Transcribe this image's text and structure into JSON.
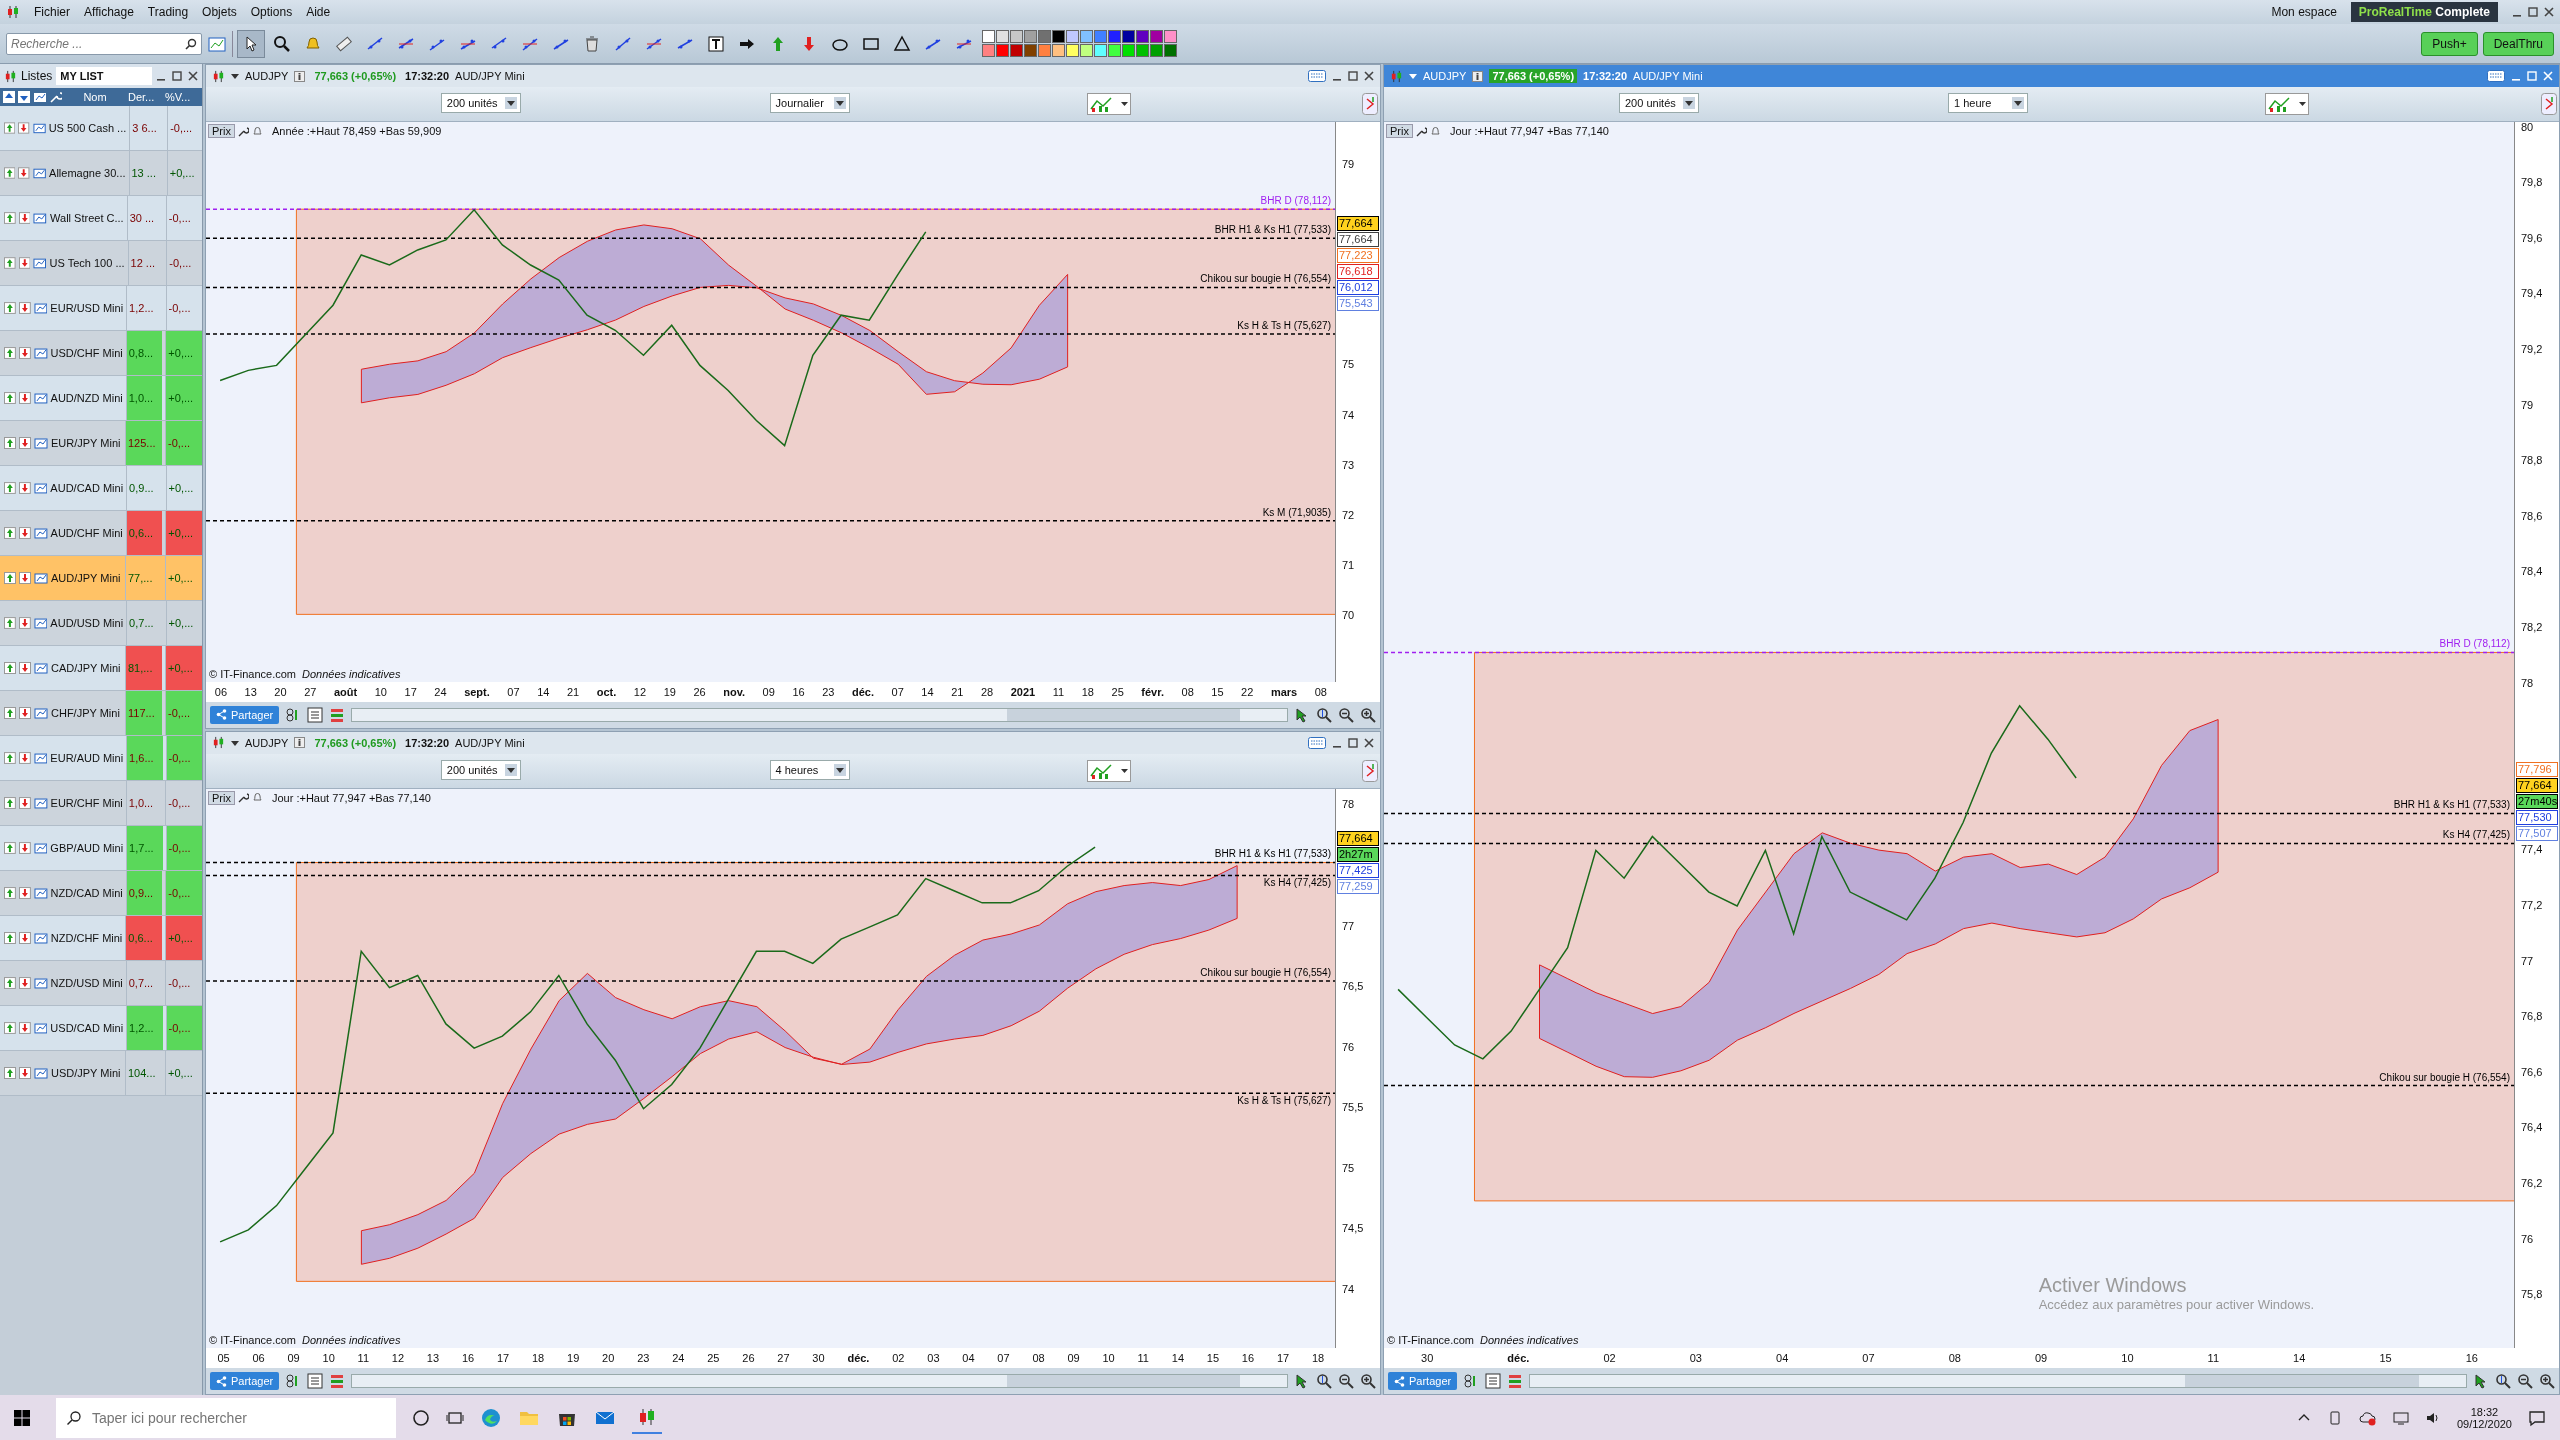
{
  "menu": [
    "Fichier",
    "Affichage",
    "Trading",
    "Objets",
    "Options",
    "Aide"
  ],
  "top_right": {
    "workspace": "Mon espace",
    "brand": "ProRealTime",
    "edition": "Complete"
  },
  "toolbar": {
    "search_placeholder": "Recherche ...",
    "buttons": [
      "Push+",
      "DealThru"
    ],
    "palette": [
      {
        "color": "#ffffff"
      },
      {
        "color": "#e0e0e0"
      },
      {
        "color": "#c8c8c8"
      },
      {
        "color": "#a0a0a0"
      },
      {
        "color": "#707070"
      },
      {
        "color": "#000000"
      },
      {
        "color": "#c0c8ff"
      },
      {
        "color": "#80c0ff"
      },
      {
        "color": "#4080ff"
      },
      {
        "color": "#2020ff"
      },
      {
        "color": "#0000a0"
      },
      {
        "color": "#6000c0"
      },
      {
        "color": "#a000a0"
      },
      {
        "color": "#ff90c8"
      },
      {
        "color": "#ff8080"
      },
      {
        "color": "#ff0000"
      },
      {
        "color": "#c00000"
      },
      {
        "color": "#804000"
      },
      {
        "color": "#ff8040"
      },
      {
        "color": "#ffc080"
      },
      {
        "color": "#ffff60"
      },
      {
        "color": "#c0ff80"
      },
      {
        "color": "#60ffff"
      },
      {
        "color": "#40ff40"
      },
      {
        "color": "#00e000"
      },
      {
        "color": "#00c000"
      },
      {
        "color": "#00a000"
      },
      {
        "color": "#007000"
      }
    ]
  },
  "watchlist": {
    "tab": "Listes",
    "list_name": "MY LIST",
    "columns": [
      "Nom",
      "Der...",
      "%V..."
    ],
    "rows": [
      {
        "name": "US 500 Cash ...",
        "last": {
          "text": "3 6...",
          "rising": false
        },
        "change": {
          "text": "-0,...",
          "rising": false
        },
        "selected": false
      },
      {
        "name": "Allemagne 30...",
        "last": {
          "text": "13 ...",
          "rising": true
        },
        "change": {
          "text": "+0,...",
          "rising": true
        },
        "selected": false
      },
      {
        "name": "Wall Street C...",
        "last": {
          "text": "30 ...",
          "rising": false
        },
        "change": {
          "text": "-0,...",
          "rising": false
        },
        "selected": false
      },
      {
        "name": "US Tech 100 ...",
        "last": {
          "text": "12 ...",
          "rising": false
        },
        "change": {
          "text": "-0,...",
          "rising": false
        },
        "selected": false
      },
      {
        "name": "EUR/USD Mini",
        "last": {
          "text": "1,2...",
          "rising": false
        },
        "change": {
          "text": "-0,...",
          "rising": false
        },
        "selected": false
      },
      {
        "name": "USD/CHF Mini",
        "last": {
          "text": "0,8...",
          "rising": true
        },
        "change": {
          "text": "+0,...",
          "rising": true
        },
        "color": "#5ad85a",
        "selected": false
      },
      {
        "name": "AUD/NZD Mini",
        "last": {
          "text": "1,0...",
          "rising": true
        },
        "change": {
          "text": "+0,...",
          "rising": true
        },
        "color": "#5ad85a",
        "selected": false
      },
      {
        "name": "EUR/JPY Mini",
        "last": {
          "text": "125...",
          "rising": false
        },
        "change": {
          "text": "-0,...",
          "rising": false
        },
        "color": "#5ad85a",
        "selected": false
      },
      {
        "name": "AUD/CAD Mini",
        "last": {
          "text": "0,9...",
          "rising": true
        },
        "change": {
          "text": "+0,...",
          "rising": true
        },
        "selected": false
      },
      {
        "name": "AUD/CHF Mini",
        "last": {
          "text": "0,6...",
          "rising": true
        },
        "change": {
          "text": "+0,...",
          "rising": true
        },
        "color": "#f05050",
        "selected": false
      },
      {
        "name": "AUD/JPY Mini",
        "last": {
          "text": "77,...",
          "rising": true
        },
        "change": {
          "text": "+0,...",
          "rising": true
        },
        "selected": true
      },
      {
        "name": "AUD/USD Mini",
        "last": {
          "text": "0,7...",
          "rising": true
        },
        "change": {
          "text": "+0,...",
          "rising": true
        },
        "selected": false
      },
      {
        "name": "CAD/JPY Mini",
        "last": {
          "text": "81,...",
          "rising": true
        },
        "change": {
          "text": "+0,...",
          "rising": true
        },
        "color": "#f05050",
        "selected": false
      },
      {
        "name": "CHF/JPY Mini",
        "last": {
          "text": "117...",
          "rising": false
        },
        "change": {
          "text": "-0,...",
          "rising": false
        },
        "color": "#5ad85a",
        "selected": false
      },
      {
        "name": "EUR/AUD Mini",
        "last": {
          "text": "1,6...",
          "rising": false
        },
        "change": {
          "text": "-0,...",
          "rising": false
        },
        "color": "#5ad85a",
        "selected": false
      },
      {
        "name": "EUR/CHF Mini",
        "last": {
          "text": "1,0...",
          "rising": false
        },
        "change": {
          "text": "-0,...",
          "rising": false
        },
        "selected": false
      },
      {
        "name": "GBP/AUD Mini",
        "last": {
          "text": "1,7...",
          "rising": true
        },
        "change": {
          "text": "-0,...",
          "rising": false
        },
        "color": "#5ad85a",
        "selected": false
      },
      {
        "name": "NZD/CAD Mini",
        "last": {
          "text": "0,9...",
          "rising": false
        },
        "change": {
          "text": "-0,...",
          "rising": false
        },
        "color": "#5ad85a",
        "selected": false
      },
      {
        "name": "NZD/CHF Mini",
        "last": {
          "text": "0,6...",
          "rising": true
        },
        "change": {
          "text": "+0,...",
          "rising": true
        },
        "color": "#f05050",
        "selected": false
      },
      {
        "name": "NZD/USD Mini",
        "last": {
          "text": "0,7...",
          "rising": false
        },
        "change": {
          "text": "-0,...",
          "rising": false
        },
        "selected": false
      },
      {
        "name": "USD/CAD Mini",
        "last": {
          "text": "1,2...",
          "rising": true
        },
        "change": {
          "text": "-0,...",
          "rising": false
        },
        "color": "#5ad85a",
        "selected": false
      },
      {
        "name": "USD/JPY Mini",
        "last": {
          "text": "104...",
          "rising": true
        },
        "change": {
          "text": "+0,...",
          "rising": true
        },
        "selected": false
      }
    ]
  },
  "charts": [
    {
      "active": false,
      "symbol": "AUDJPY",
      "quote": "77,663 (+0,65%)",
      "time": "17:32:20",
      "instrument": "AUD/JPY Mini",
      "units": "200 unités",
      "period": "Journalier",
      "legend": "Prix",
      "range": "Année :+Haut 78,459 +Bas 59,909",
      "credit": "© IT-Finance.com",
      "disclaimer": "Données indicatives",
      "share": "Partager",
      "time_axis": [
        {
          "label": "06",
          "major": false
        },
        {
          "label": "13",
          "major": false
        },
        {
          "label": "20",
          "major": false
        },
        {
          "label": "27",
          "major": false
        },
        {
          "label": "août",
          "major": true
        },
        {
          "label": "10",
          "major": false
        },
        {
          "label": "17",
          "major": false
        },
        {
          "label": "24",
          "major": false
        },
        {
          "label": "sept.",
          "major": true
        },
        {
          "label": "07",
          "major": false
        },
        {
          "label": "14",
          "major": false
        },
        {
          "label": "21",
          "major": false
        },
        {
          "label": "oct.",
          "major": true
        },
        {
          "label": "12",
          "major": false
        },
        {
          "label": "19",
          "major": false
        },
        {
          "label": "26",
          "major": false
        },
        {
          "label": "nov.",
          "major": true
        },
        {
          "label": "09",
          "major": false
        },
        {
          "label": "16",
          "major": false
        },
        {
          "label": "23",
          "major": false
        },
        {
          "label": "déc.",
          "major": true
        },
        {
          "label": "07",
          "major": false
        },
        {
          "label": "14",
          "major": false
        },
        {
          "label": "21",
          "major": false
        },
        {
          "label": "28",
          "major": false
        },
        {
          "label": "2021",
          "major": true
        },
        {
          "label": "11",
          "major": false
        },
        {
          "label": "18",
          "major": false
        },
        {
          "label": "25",
          "major": false
        },
        {
          "label": "févr.",
          "major": true
        },
        {
          "label": "08",
          "major": false
        },
        {
          "label": "15",
          "major": false
        },
        {
          "label": "22",
          "major": false
        },
        {
          "label": "mars",
          "major": true
        },
        {
          "label": "08",
          "major": false
        }
      ],
      "price_tags": [
        {
          "text": "77,664",
          "kind": "last",
          "color": "#000000"
        },
        {
          "text": "77,664",
          "kind": "line",
          "color": "#404040"
        },
        {
          "text": "77,223",
          "kind": "line",
          "color": "#f07020"
        },
        {
          "text": "76,618",
          "kind": "line",
          "color": "#e02020"
        },
        {
          "text": "76,012",
          "kind": "line",
          "color": "#2040e0"
        },
        {
          "text": "75,543",
          "kind": "line",
          "color": "#6080e0"
        }
      ],
      "chart_data": {
        "type": "line",
        "ylim": [
          68.7,
          79.85
        ],
        "yticks": [
          {
            "value": 79,
            "label": "79"
          },
          {
            "value": 75,
            "label": "75"
          },
          {
            "value": 74,
            "label": "74"
          },
          {
            "value": 73,
            "label": "73"
          },
          {
            "value": 72,
            "label": "72"
          },
          {
            "value": 71,
            "label": "71"
          },
          {
            "value": 70,
            "label": "70"
          }
        ],
        "series": [
          {
            "color": "#1a6a1a",
            "values": [
              74.7,
              74.9,
              75.0,
              75.6,
              76.2,
              77.2,
              77.0,
              77.3,
              77.5,
              78.1,
              77.4,
              77.0,
              76.7,
              76.0,
              75.7,
              75.2,
              75.8,
              75.0,
              74.5,
              73.9,
              73.4,
              75.2,
              76.0,
              75.9,
              76.8,
              77.66,
              null,
              null,
              null,
              null,
              null,
              null,
              null,
              null,
              null,
              null,
              null,
              null,
              null,
              null
            ]
          }
        ],
        "ref_lines": [
          {
            "axis": "y",
            "value": 78.112,
            "label": "BHR D (78,112)",
            "color": "#a020f0"
          },
          {
            "axis": "y",
            "value": 77.533,
            "label": "BHR H1 & Ks H1 (77,533)",
            "color": "#000000"
          },
          {
            "axis": "y",
            "value": 76.554,
            "label": "Chikou sur bougie H (76,554)",
            "color": "#000000"
          },
          {
            "axis": "y",
            "value": 75.627,
            "label": "Ks H & Ts H (75,627)",
            "color": "#000000"
          },
          {
            "axis": "y",
            "value": 71.9035,
            "label": "Ks M (71,9035)",
            "color": "#000000"
          }
        ]
      }
    },
    {
      "active": false,
      "symbol": "AUDJPY",
      "quote": "77,663 (+0,65%)",
      "time": "17:32:20",
      "instrument": "AUD/JPY Mini",
      "units": "200 unités",
      "period": "4 heures",
      "legend": "Prix",
      "range": "Jour :+Haut 77,947 +Bas 77,140",
      "credit": "© IT-Finance.com",
      "disclaimer": "Données indicatives",
      "share": "Partager",
      "time_axis": [
        {
          "label": "05",
          "major": false
        },
        {
          "label": "06",
          "major": false
        },
        {
          "label": "09",
          "major": false
        },
        {
          "label": "10",
          "major": false
        },
        {
          "label": "11",
          "major": false
        },
        {
          "label": "12",
          "major": false
        },
        {
          "label": "13",
          "major": false
        },
        {
          "label": "16",
          "major": false
        },
        {
          "label": "17",
          "major": false
        },
        {
          "label": "18",
          "major": false
        },
        {
          "label": "19",
          "major": false
        },
        {
          "label": "20",
          "major": false
        },
        {
          "label": "23",
          "major": false
        },
        {
          "label": "24",
          "major": false
        },
        {
          "label": "25",
          "major": false
        },
        {
          "label": "26",
          "major": false
        },
        {
          "label": "27",
          "major": false
        },
        {
          "label": "30",
          "major": false
        },
        {
          "label": "déc.",
          "major": true
        },
        {
          "label": "02",
          "major": false
        },
        {
          "label": "03",
          "major": false
        },
        {
          "label": "04",
          "major": false
        },
        {
          "label": "07",
          "major": false
        },
        {
          "label": "08",
          "major": false
        },
        {
          "label": "09",
          "major": false
        },
        {
          "label": "10",
          "major": false
        },
        {
          "label": "11",
          "major": false
        },
        {
          "label": "14",
          "major": false
        },
        {
          "label": "15",
          "major": false
        },
        {
          "label": "16",
          "major": false
        },
        {
          "label": "17",
          "major": false
        },
        {
          "label": "18",
          "major": false
        }
      ],
      "price_tags": [
        {
          "text": "77,664",
          "kind": "last",
          "color": "#000000"
        },
        {
          "text": "2h27m",
          "kind": "timer",
          "color": "#000000"
        },
        {
          "text": "77,425",
          "kind": "line",
          "color": "#2040e0"
        },
        {
          "text": "77,259",
          "kind": "line",
          "color": "#6080e0"
        }
      ],
      "chart_data": {
        "type": "line",
        "ylim": [
          73.52,
          78.14
        ],
        "yticks": [
          {
            "value": 78,
            "label": "78"
          },
          {
            "value": 77,
            "label": "77"
          },
          {
            "value": 76.5,
            "label": "76,5"
          },
          {
            "value": 76,
            "label": "76"
          },
          {
            "value": 75.5,
            "label": "75,5"
          },
          {
            "value": 75,
            "label": "75"
          },
          {
            "value": 74.5,
            "label": "74,5"
          },
          {
            "value": 74,
            "label": "74"
          }
        ],
        "series": [
          {
            "color": "#1a6a1a",
            "values": [
              74.4,
              74.5,
              74.7,
              75.0,
              75.3,
              76.8,
              76.5,
              76.6,
              76.2,
              76.0,
              76.1,
              76.3,
              76.6,
              76.2,
              75.9,
              75.5,
              75.7,
              76.0,
              76.4,
              76.8,
              76.8,
              76.7,
              76.9,
              77.0,
              77.1,
              77.4,
              77.3,
              77.2,
              77.2,
              77.3,
              77.5,
              77.66,
              null,
              null,
              null,
              null,
              null,
              null,
              null,
              null
            ]
          }
        ],
        "ref_lines": [
          {
            "axis": "y",
            "value": 77.533,
            "label": "BHR H1 & Ks H1 (77,533)",
            "color": "#000000"
          },
          {
            "axis": "y",
            "value": 77.425,
            "label": "Ks H4 (77,425)",
            "color": "#000000"
          },
          {
            "axis": "y",
            "value": 76.554,
            "label": "Chikou sur bougie H (76,554)",
            "color": "#000000"
          },
          {
            "axis": "y",
            "value": 75.627,
            "label": "Ks H & Ts H (75,627)",
            "color": "#000000"
          }
        ]
      }
    },
    {
      "active": true,
      "symbol": "AUDJPY",
      "quote": "77,663 (+0,65%)",
      "time": "17:32:20",
      "instrument": "AUD/JPY Mini",
      "units": "200 unités",
      "period": "1 heure",
      "legend": "Prix",
      "range": "Jour :+Haut 77,947 +Bas 77,140",
      "credit": "© IT-Finance.com",
      "disclaimer": "Données indicatives",
      "share": "Partager",
      "time_axis": [
        {
          "label": "30",
          "major": false
        },
        {
          "label": "déc.",
          "major": true
        },
        {
          "label": "02",
          "major": false
        },
        {
          "label": "03",
          "major": false
        },
        {
          "label": "04",
          "major": false
        },
        {
          "label": "07",
          "major": false
        },
        {
          "label": "08",
          "major": false
        },
        {
          "label": "09",
          "major": false
        },
        {
          "label": "10",
          "major": false
        },
        {
          "label": "11",
          "major": false
        },
        {
          "label": "14",
          "major": false
        },
        {
          "label": "15",
          "major": false
        },
        {
          "label": "16",
          "major": false
        }
      ],
      "price_tags": [
        {
          "text": "77,796",
          "kind": "line",
          "color": "#f07020"
        },
        {
          "text": "77,664",
          "kind": "last",
          "color": "#000000"
        },
        {
          "text": "27m40s",
          "kind": "timer",
          "color": "#000000"
        },
        {
          "text": "77,530",
          "kind": "line",
          "color": "#2040e0"
        },
        {
          "text": "77,507",
          "kind": "line",
          "color": "#6080e0"
        }
      ],
      "chart_data": {
        "type": "line",
        "ylim": [
          75.61,
          80.02
        ],
        "yticks": [
          {
            "value": 80,
            "label": "80"
          },
          {
            "value": 79.8,
            "label": "79,8"
          },
          {
            "value": 79.6,
            "label": "79,6"
          },
          {
            "value": 79.4,
            "label": "79,4"
          },
          {
            "value": 79.2,
            "label": "79,2"
          },
          {
            "value": 79,
            "label": "79"
          },
          {
            "value": 78.8,
            "label": "78,8"
          },
          {
            "value": 78.6,
            "label": "78,6"
          },
          {
            "value": 78.4,
            "label": "78,4"
          },
          {
            "value": 78.2,
            "label": "78,2"
          },
          {
            "value": 78,
            "label": "78"
          },
          {
            "value": 77.4,
            "label": "77,4"
          },
          {
            "value": 77.2,
            "label": "77,2"
          },
          {
            "value": 77,
            "label": "77"
          },
          {
            "value": 76.8,
            "label": "76,8"
          },
          {
            "value": 76.6,
            "label": "76,6"
          },
          {
            "value": 76.4,
            "label": "76,4"
          },
          {
            "value": 76.2,
            "label": "76,2"
          },
          {
            "value": 76,
            "label": "76"
          },
          {
            "value": 75.8,
            "label": "75,8"
          }
        ],
        "series": [
          {
            "color": "#1a6a1a",
            "values": [
              76.9,
              76.8,
              76.7,
              76.65,
              76.75,
              76.9,
              77.05,
              77.4,
              77.3,
              77.45,
              77.35,
              77.25,
              77.2,
              77.4,
              77.1,
              77.45,
              77.25,
              77.2,
              77.15,
              77.3,
              77.5,
              77.75,
              77.92,
              77.8,
              77.66,
              null,
              null,
              null,
              null,
              null,
              null,
              null,
              null,
              null,
              null,
              null,
              null,
              null,
              null,
              null
            ]
          }
        ],
        "ref_lines": [
          {
            "axis": "y",
            "value": 78.112,
            "label": "BHR D (78,112)",
            "color": "#a020f0"
          },
          {
            "axis": "y",
            "value": 77.533,
            "label": "BHR H1 & Ks H1 (77,533)",
            "color": "#000000"
          },
          {
            "axis": "y",
            "value": 77.425,
            "label": "Ks H4 (77,425)",
            "color": "#000000"
          },
          {
            "axis": "y",
            "value": 76.554,
            "label": "Chikou sur bougie H (76,554)",
            "color": "#000000"
          }
        ]
      }
    }
  ],
  "activation_notice": {
    "title": "Activer Windows",
    "text": "Accédez aux paramètres pour activer Windows."
  },
  "taskbar": {
    "search_placeholder": "Taper ici pour rechercher",
    "time": "18:32",
    "date": "09/12/2020"
  }
}
